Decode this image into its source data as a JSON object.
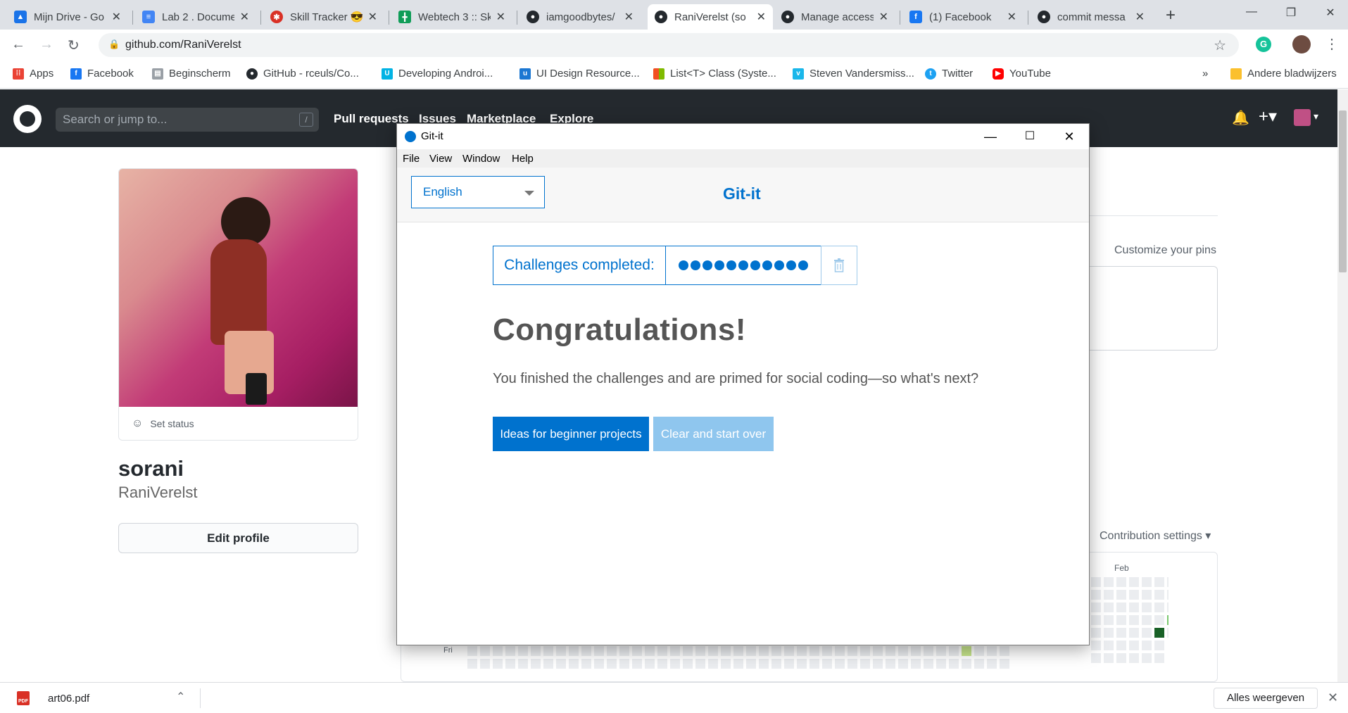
{
  "browser": {
    "tabs": [
      {
        "title": "Mijn Drive - Go",
        "icon": "google-drive-icon",
        "color": "#1a73e8"
      },
      {
        "title": "Lab 2 . Docume",
        "icon": "google-docs-icon",
        "color": "#4285f4"
      },
      {
        "title": "Skill Tracker 😎",
        "icon": "skill-tracker-icon",
        "color": "#d93025"
      },
      {
        "title": "Webtech 3 :: Sk",
        "icon": "google-sheets-icon",
        "color": "#0f9d58"
      },
      {
        "title": "iamgoodbytes/",
        "icon": "github-icon",
        "color": "#24292e"
      },
      {
        "title": "RaniVerelst (so",
        "icon": "github-icon",
        "color": "#24292e"
      },
      {
        "title": "Manage access",
        "icon": "github-icon",
        "color": "#24292e"
      },
      {
        "title": "(1) Facebook",
        "icon": "facebook-icon",
        "color": "#1877f2"
      },
      {
        "title": "commit messa",
        "icon": "github-icon",
        "color": "#24292e"
      }
    ],
    "url": "github.com/RaniVerelst",
    "bookmarks": [
      {
        "label": "Apps",
        "icon": "apps-grid-icon",
        "color": "#ea4335"
      },
      {
        "label": "Facebook",
        "icon": "facebook-icon",
        "color": "#1877f2"
      },
      {
        "label": "Beginscherm",
        "icon": "bookmark-page-icon",
        "color": "#5f6368"
      },
      {
        "label": "GitHub - rceuls/Co...",
        "icon": "github-icon",
        "color": "#24292e"
      },
      {
        "label": "Developing Androi...",
        "icon": "udacity-icon",
        "color": "#02b3e4"
      },
      {
        "label": "UI Design Resource...",
        "icon": "uxpin-icon",
        "color": "#1b77d2"
      },
      {
        "label": "List<T> Class (Syste...",
        "icon": "microsoft-icon",
        "color": "#f25022"
      },
      {
        "label": "Steven Vandersmiss...",
        "icon": "vimeo-icon",
        "color": "#1ab7ea"
      },
      {
        "label": "Twitter",
        "icon": "twitter-icon",
        "color": "#1da1f2"
      },
      {
        "label": "YouTube",
        "icon": "youtube-icon",
        "color": "#ff0000"
      }
    ],
    "overflow": "»",
    "other_bookmarks": "Andere bladwijzers",
    "download": {
      "file": "art06.pdf",
      "show_all": "Alles weergeven"
    }
  },
  "github": {
    "search_placeholder": "Search or jump to...",
    "search_key": "/",
    "nav": [
      "Pull requests",
      "Issues",
      "Marketplace",
      "Explore"
    ],
    "set_status": "Set status",
    "name": "sorani",
    "login": "RaniVerelst",
    "edit_profile": "Edit profile",
    "customize_pins": "Customize your pins",
    "contribution_settings": "Contribution settings ▾",
    "graph_month": "Feb",
    "graph_day": "Fri"
  },
  "gitit": {
    "window_title": "Git-it",
    "menu": [
      "File",
      "View",
      "Window",
      "Help"
    ],
    "language": "English",
    "brand": "Git-it",
    "challenges_label": "Challenges completed:",
    "challenges_completed": 11,
    "heading": "Congratulations!",
    "message": "You finished the challenges and are primed for social coding—so what's next?",
    "btn_ideas": "Ideas for beginner projects",
    "btn_clear": "Clear and start over",
    "accent": "#0072ce"
  }
}
